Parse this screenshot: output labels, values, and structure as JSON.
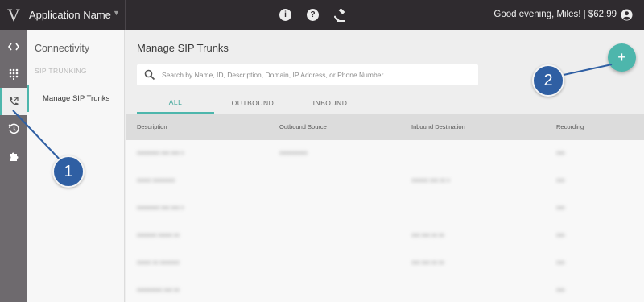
{
  "topbar": {
    "logo_letter": "V",
    "app_name": "Application Name",
    "greeting": "Good evening, Miles! | $62.99",
    "icons": [
      "info-icon",
      "help-icon",
      "gavel-icon",
      "account-icon"
    ]
  },
  "rail": {
    "items": [
      "code-icon",
      "dialpad-icon",
      "phone-forward-icon",
      "history-icon",
      "extension-icon"
    ],
    "active_index": 2
  },
  "sidebar": {
    "title": "Connectivity",
    "section": "SIP TRUNKING",
    "items": [
      {
        "label": "Manage SIP Trunks"
      }
    ]
  },
  "main": {
    "title": "Manage SIP Trunks",
    "search_placeholder": "Search by Name, ID, Description, Domain, IP Address, or Phone Number",
    "tabs": [
      {
        "label": "ALL"
      },
      {
        "label": "OUTBOUND"
      },
      {
        "label": "INBOUND"
      }
    ],
    "active_tab": 0,
    "add_label": "+",
    "columns": [
      "Description",
      "Outbound Source",
      "Inbound Destination",
      "Recording"
    ],
    "rows": [
      [
        "xxxxxxxx xxx xxx x",
        "xxxxxxxxxx",
        "",
        "xxx"
      ],
      [
        "xxxxx xxxxxxxx",
        "",
        "xxxxxx xxx xx x",
        "xxx"
      ],
      [
        "xxxxxxxx xxx xxx x",
        "",
        "",
        "xxx"
      ],
      [
        "xxxxxxx xxxxx xx",
        "",
        "xxx xxx xx xx",
        "xxx"
      ],
      [
        "xxxxx xx xxxxxxx",
        "",
        "xxx xxx xx xx",
        "xxx"
      ],
      [
        "xxxxxxxxx xxx xx",
        "",
        "",
        "xxx"
      ]
    ]
  },
  "callouts": [
    {
      "label": "1"
    },
    {
      "label": "2"
    }
  ],
  "colors": {
    "accent": "#4db6ac",
    "topbar": "#2f2b2f",
    "rail": "#6e6a6e",
    "callout": "#2f5fa3"
  }
}
